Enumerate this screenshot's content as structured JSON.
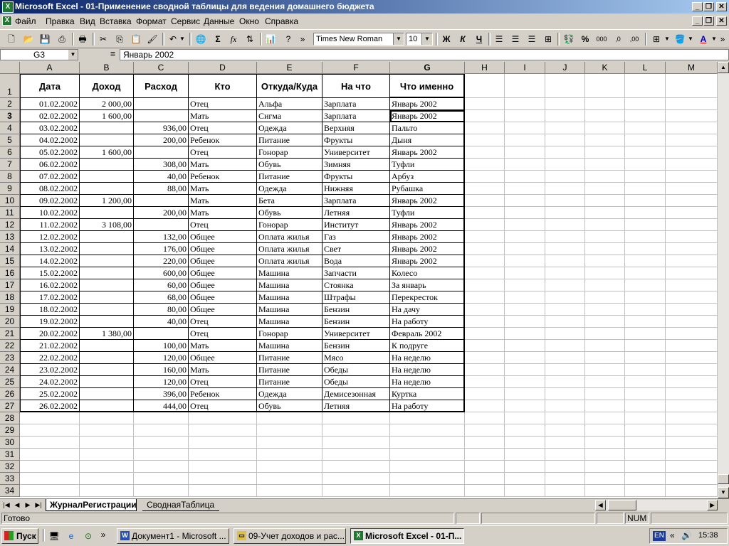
{
  "window": {
    "title": "Microsoft Excel - 01-Применение сводной таблицы для ведения домашнего бюджета",
    "app_icon": "excel-icon"
  },
  "menu": [
    "Файл",
    "Правка",
    "Вид",
    "Вставка",
    "Формат",
    "Сервис",
    "Данные",
    "Окно",
    "Справка"
  ],
  "toolbar": {
    "font_name": "Times New Roman",
    "font_size": "10",
    "bold": "Ж",
    "italic": "К",
    "underline": "Ч",
    "sum": "Σ",
    "fx": "fx",
    "percent": "%",
    "thousands": "000"
  },
  "formula_bar": {
    "name_box": "G3",
    "equals": "=",
    "content": "Январь 2002"
  },
  "columns": [
    "A",
    "B",
    "C",
    "D",
    "E",
    "F",
    "G",
    "H",
    "I",
    "J",
    "K",
    "L",
    "M"
  ],
  "table": {
    "headers": [
      "Дата",
      "Доход",
      "Расход",
      "Кто",
      "Откуда/Куда",
      "На что",
      "Что именно"
    ],
    "rows": [
      [
        "01.02.2002",
        "2 000,00",
        "",
        "Отец",
        "Альфа",
        "Зарплата",
        "Январь 2002"
      ],
      [
        "02.02.2002",
        "1 600,00",
        "",
        "Мать",
        "Сигма",
        "Зарплата",
        "Январь 2002"
      ],
      [
        "03.02.2002",
        "",
        "936,00",
        "Отец",
        "Одежда",
        "Верхняя",
        "Пальто"
      ],
      [
        "04.02.2002",
        "",
        "200,00",
        "Ребенок",
        "Питание",
        "Фрукты",
        "Дыня"
      ],
      [
        "05.02.2002",
        "1 600,00",
        "",
        "Отец",
        "Гонорар",
        "Университет",
        "Январь 2002"
      ],
      [
        "06.02.2002",
        "",
        "308,00",
        "Мать",
        "Обувь",
        "Зимняя",
        "Туфли"
      ],
      [
        "07.02.2002",
        "",
        "40,00",
        "Ребенок",
        "Питание",
        "Фрукты",
        "Арбуз"
      ],
      [
        "08.02.2002",
        "",
        "88,00",
        "Мать",
        "Одежда",
        "Нижняя",
        "Рубашка"
      ],
      [
        "09.02.2002",
        "1 200,00",
        "",
        "Мать",
        "Бета",
        "Зарплата",
        "Январь 2002"
      ],
      [
        "10.02.2002",
        "",
        "200,00",
        "Мать",
        "Обувь",
        "Летняя",
        "Туфли"
      ],
      [
        "11.02.2002",
        "3 108,00",
        "",
        "Отец",
        "Гонорар",
        "Институт",
        "Январь 2002"
      ],
      [
        "12.02.2002",
        "",
        "132,00",
        "Общее",
        "Оплата жилья",
        "Газ",
        "Январь 2002"
      ],
      [
        "13.02.2002",
        "",
        "176,00",
        "Общее",
        "Оплата жилья",
        "Свет",
        "Январь 2002"
      ],
      [
        "14.02.2002",
        "",
        "220,00",
        "Общее",
        "Оплата жилья",
        "Вода",
        "Январь 2002"
      ],
      [
        "15.02.2002",
        "",
        "600,00",
        "Общее",
        "Машина",
        "Запчасти",
        "Колесо"
      ],
      [
        "16.02.2002",
        "",
        "60,00",
        "Общее",
        "Машина",
        "Стоянка",
        "За январь"
      ],
      [
        "17.02.2002",
        "",
        "68,00",
        "Общее",
        "Машина",
        "Штрафы",
        "Перекресток"
      ],
      [
        "18.02.2002",
        "",
        "80,00",
        "Общее",
        "Машина",
        "Бензин",
        "На дачу"
      ],
      [
        "19.02.2002",
        "",
        "40,00",
        "Отец",
        "Машина",
        "Бензин",
        "На работу"
      ],
      [
        "20.02.2002",
        "1 380,00",
        "",
        "Отец",
        "Гонорар",
        "Университет",
        "Февраль 2002"
      ],
      [
        "21.02.2002",
        "",
        "100,00",
        "Мать",
        "Машина",
        "Бензин",
        "К подруге"
      ],
      [
        "22.02.2002",
        "",
        "120,00",
        "Общее",
        "Питание",
        "Мясо",
        "На неделю"
      ],
      [
        "23.02.2002",
        "",
        "160,00",
        "Мать",
        "Питание",
        "Обеды",
        "На неделю"
      ],
      [
        "24.02.2002",
        "",
        "120,00",
        "Отец",
        "Питание",
        "Обеды",
        "На неделю"
      ],
      [
        "25.02.2002",
        "",
        "396,00",
        "Ребенок",
        "Одежда",
        "Демисезонная",
        "Куртка"
      ],
      [
        "26.02.2002",
        "",
        "444,00",
        "Отец",
        "Обувь",
        "Летняя",
        "На работу"
      ]
    ]
  },
  "row_numbers": [
    "1",
    "2",
    "3",
    "4",
    "5",
    "6",
    "7",
    "8",
    "9",
    "10",
    "11",
    "12",
    "13",
    "14",
    "15",
    "16",
    "17",
    "18",
    "19",
    "20",
    "21",
    "22",
    "23",
    "24",
    "25",
    "26",
    "27",
    "28",
    "29",
    "30",
    "31",
    "32",
    "33",
    "34"
  ],
  "sheets": [
    "ЖурналРегистрации",
    "СводнаяТаблица"
  ],
  "status": {
    "ready": "Готово",
    "num": "NUM"
  },
  "taskbar": {
    "start": "Пуск",
    "tasks": [
      "Документ1 - Microsoft ...",
      "09-Учет доходов и рас...",
      "Microsoft Excel - 01-П..."
    ],
    "lang": "EN",
    "time": "15:38",
    "chevron": "»",
    "tray_chevron": "«"
  }
}
